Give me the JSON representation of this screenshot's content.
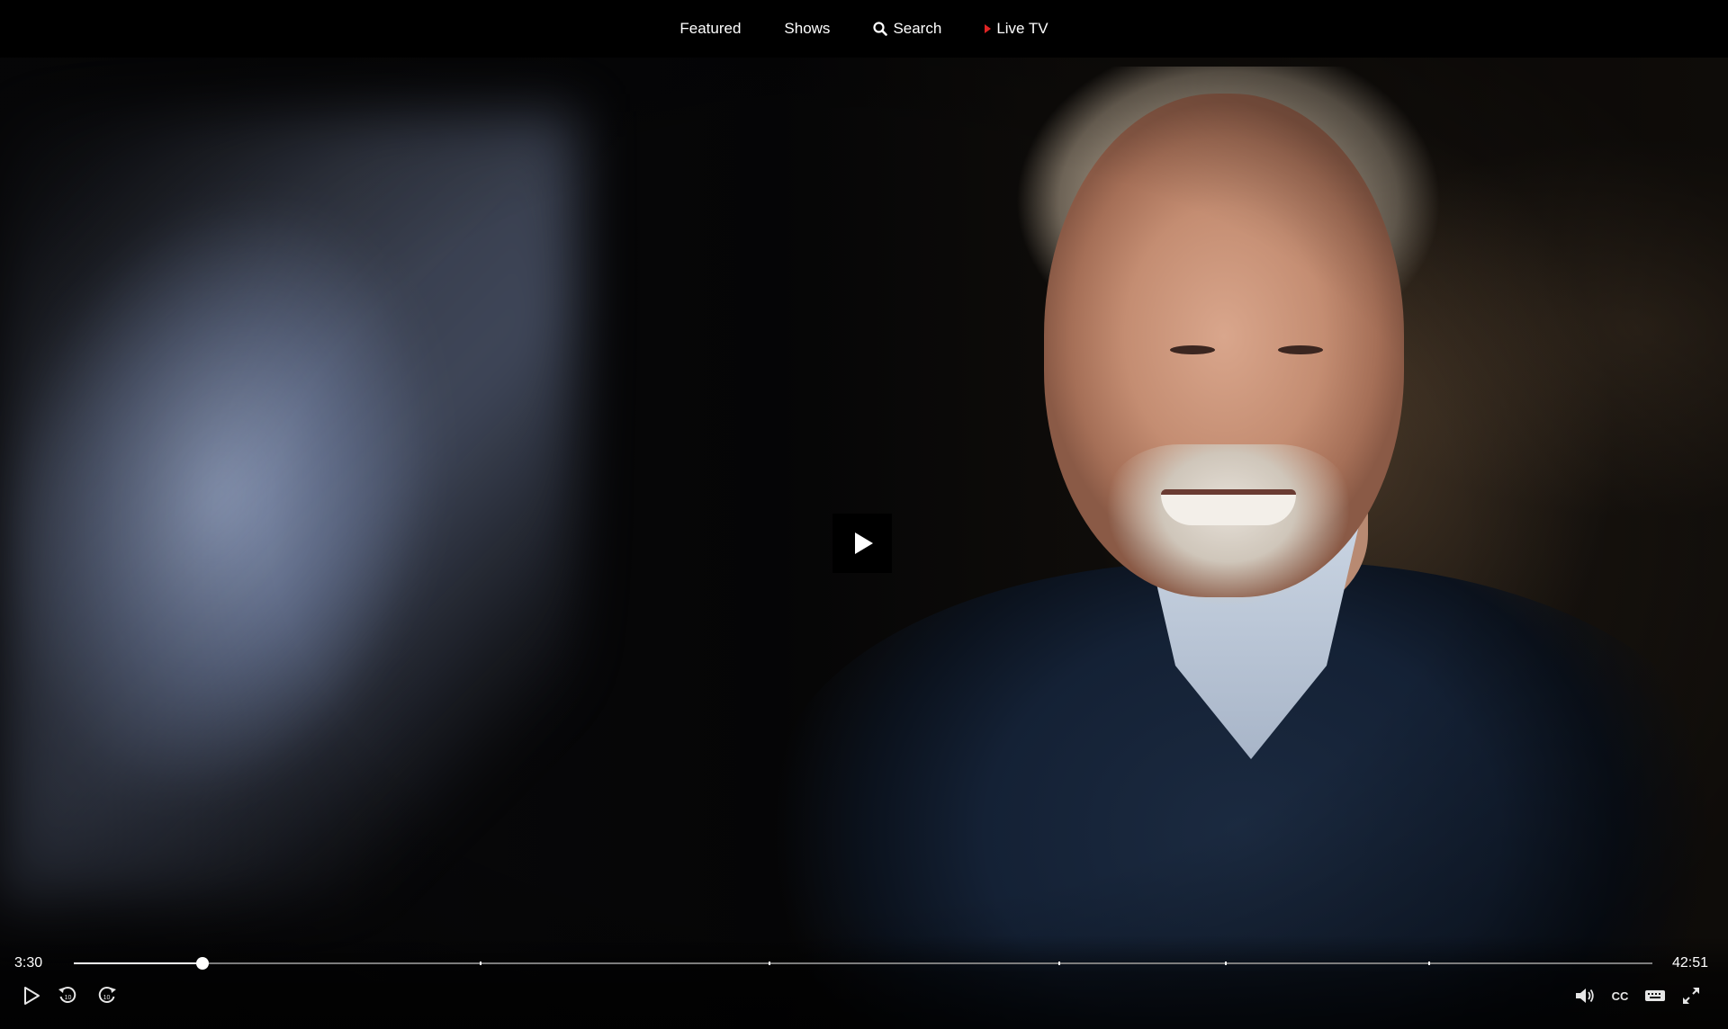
{
  "nav": {
    "items": [
      {
        "label": "Featured"
      },
      {
        "label": "Shows"
      },
      {
        "label": "Search",
        "icon": "search-icon"
      },
      {
        "label": "Live TV",
        "icon": "live-indicator-icon",
        "icon_color": "#e02424"
      }
    ]
  },
  "player": {
    "current_time": "3:30",
    "total_time": "42:51",
    "progress_fraction": 0.0817,
    "chapter_marks": [
      0.257,
      0.44,
      0.624,
      0.729,
      0.858
    ],
    "center_button_icon": "play-icon",
    "controls_left": [
      "play-icon",
      "rewind-10-icon",
      "forward-10-icon"
    ],
    "controls_right": [
      "volume-icon",
      "closed-captions-icon",
      "keyboard-icon",
      "fullscreen-icon"
    ]
  },
  "colors": {
    "background": "#000000",
    "text": "#ffffff",
    "live_accent": "#e02424",
    "track": "#7d7d7d"
  }
}
